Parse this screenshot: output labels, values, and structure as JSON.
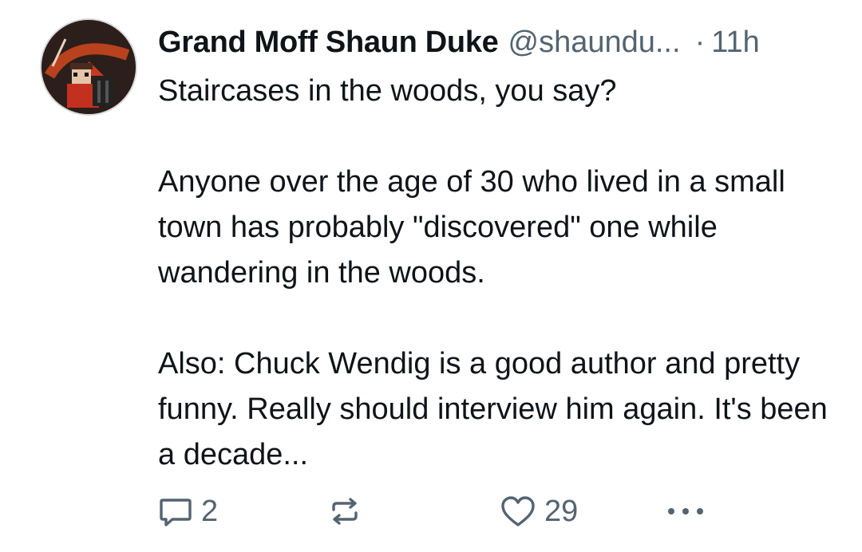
{
  "post": {
    "author": {
      "display_name": "Grand Moff Shaun Duke",
      "handle": "@shaundu...",
      "avatar_icon": "avatar-image"
    },
    "separator": "·",
    "timestamp": "11h",
    "paragraphs": [
      "Staircases in the woods, you say?",
      "Anyone over the age of 30 who lived in a small town has probably \"discovered\" one while wandering in the woods.",
      "Also: Chuck Wendig is a good author and pretty funny. Really should interview him again. It's been a decade..."
    ],
    "actions": {
      "reply_count": "2",
      "repost_count": "",
      "like_count": "29"
    }
  },
  "colors": {
    "text": "#0f1419",
    "muted": "#536471",
    "background": "#ffffff"
  }
}
